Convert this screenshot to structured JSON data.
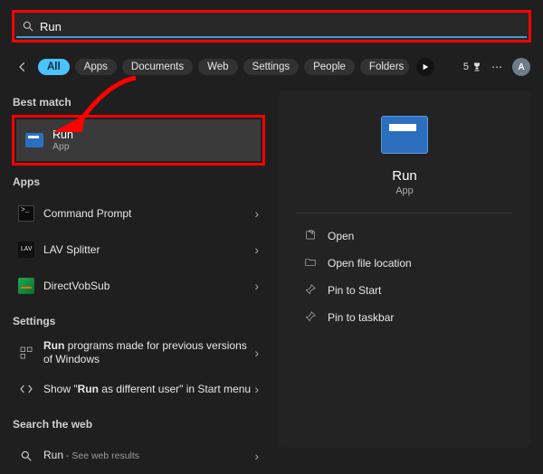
{
  "search": {
    "value": "Run"
  },
  "tabs": {
    "items": [
      "All",
      "Apps",
      "Documents",
      "Web",
      "Settings",
      "People",
      "Folders"
    ],
    "badge_count": "5",
    "avatar_initial": "A"
  },
  "left": {
    "best_match": {
      "heading": "Best match",
      "item": {
        "title": "Run",
        "subtitle": "App"
      }
    },
    "apps": {
      "heading": "Apps",
      "items": [
        {
          "label": "Command Prompt"
        },
        {
          "label": "LAV Splitter"
        },
        {
          "label": "DirectVobSub"
        }
      ]
    },
    "settings": {
      "heading": "Settings",
      "items": [
        {
          "prefix": "",
          "bold": "Run",
          "suffix": " programs made for previous versions of Windows"
        },
        {
          "prefix": "Show \"",
          "bold": "Run",
          "suffix": " as different user\" in Start menu"
        }
      ]
    },
    "web": {
      "heading": "Search the web",
      "item": {
        "label": "Run",
        "sub": " - See web results"
      }
    }
  },
  "right": {
    "title": "Run",
    "subtitle": "App",
    "actions": [
      {
        "name": "open",
        "label": "Open"
      },
      {
        "name": "open-file-location",
        "label": "Open file location"
      },
      {
        "name": "pin-to-start",
        "label": "Pin to Start"
      },
      {
        "name": "pin-to-taskbar",
        "label": "Pin to taskbar"
      }
    ]
  }
}
